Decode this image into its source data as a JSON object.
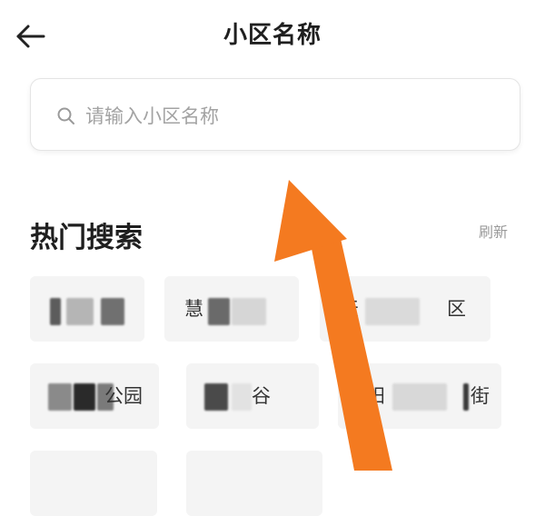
{
  "header": {
    "title": "小区名称",
    "back_icon": "arrow-left-icon"
  },
  "search": {
    "placeholder": "请输入小区名称",
    "icon": "search-icon"
  },
  "hot_search": {
    "title": "热门搜索",
    "refresh_label": "刷新",
    "chips": [
      {
        "text": ""
      },
      {
        "text": "慧"
      },
      {
        "text_left": "天",
        "text_right": "区"
      },
      {
        "text": "公园"
      },
      {
        "text": "谷"
      },
      {
        "text_left": "朝阳",
        "text_right": "街"
      }
    ]
  },
  "colors": {
    "annotation_arrow": "#f47a20",
    "chip_bg": "#f4f4f4"
  }
}
